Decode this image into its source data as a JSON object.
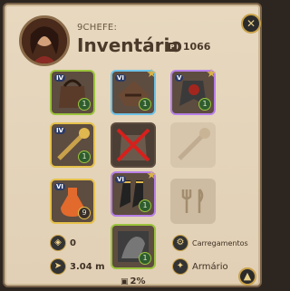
{
  "header": {
    "owner": "9CHEFE:",
    "title": "Inventário",
    "silver": "1066"
  },
  "slots": {
    "bag": {
      "tier": "IV",
      "qty": "1"
    },
    "head": {
      "tier": "VI",
      "qty": "1"
    },
    "cape": {
      "tier": "V",
      "qty": "1"
    },
    "main_hand": {
      "tier": "IV",
      "qty": "1"
    },
    "armor": {
      "tier": "",
      "qty": ""
    },
    "off_hand": {
      "tier": "",
      "qty": ""
    },
    "potion": {
      "tier": "VI",
      "qty": "9"
    },
    "shoes": {
      "tier": "VI",
      "qty": "1"
    },
    "food": {
      "tier": "",
      "qty": ""
    },
    "mount": {
      "tier": "",
      "qty": "1"
    }
  },
  "stats": {
    "fame": "0",
    "speed": "3.04 m"
  },
  "labels": {
    "loadouts": "Carregamentos",
    "wardrobe": "Armário"
  },
  "footer": {
    "weight": "2%"
  }
}
